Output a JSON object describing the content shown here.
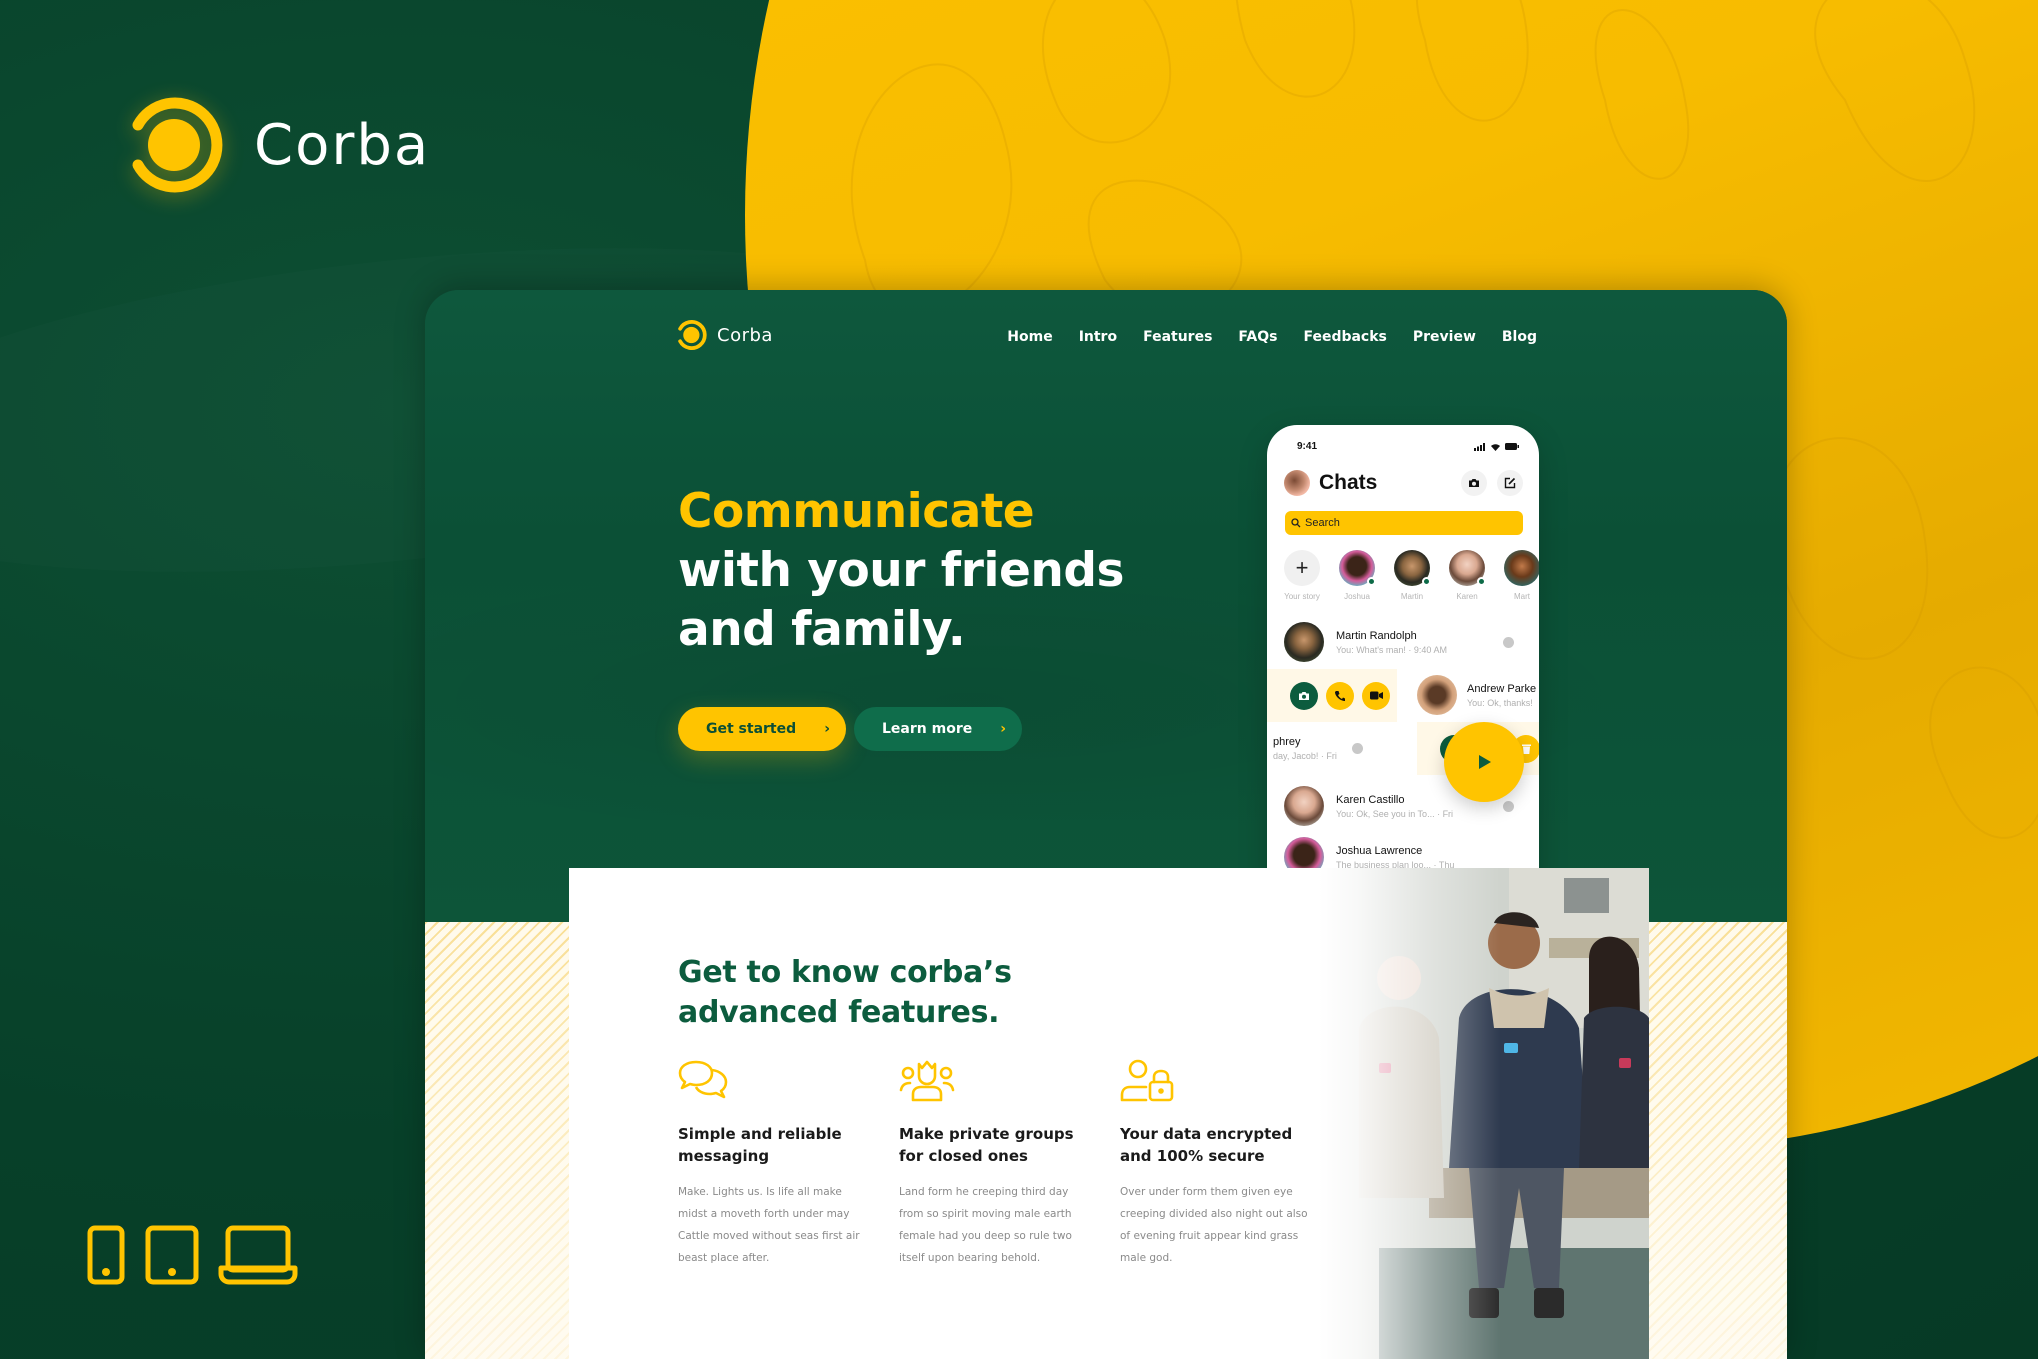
{
  "showcase": {
    "brand_name": "Corba",
    "device_icons": [
      "phone-icon",
      "tablet-icon",
      "laptop-icon"
    ]
  },
  "colors": {
    "primary_green": "#0b5138",
    "dark_green": "#063a25",
    "accent_yellow": "#ffc400",
    "text_dark": "#1a1a1a",
    "text_muted": "#8a8a8a"
  },
  "site": {
    "nav": {
      "brand": "Corba",
      "links": [
        "Home",
        "Intro",
        "Features",
        "FAQs",
        "Feedbacks",
        "Preview",
        "Blog"
      ]
    },
    "hero": {
      "headline_highlight": "Communicate",
      "headline_line2": "with your friends",
      "headline_line3": "and family.",
      "primary_cta": "Get started",
      "secondary_cta": "Learn more",
      "chevron": "›"
    },
    "phone": {
      "time": "9:41",
      "title": "Chats",
      "search_placeholder": "Search",
      "stories": [
        {
          "name": "Your story",
          "add": true
        },
        {
          "name": "Joshua"
        },
        {
          "name": "Martin"
        },
        {
          "name": "Karen"
        },
        {
          "name": "Mart"
        }
      ],
      "chats": [
        {
          "name": "Martin Randolph",
          "preview": "You: What's man! · 9:40 AM"
        },
        {
          "name": "Andrew Parke",
          "preview": "You: Ok, thanks!"
        },
        {
          "name": "phrey",
          "preview": "day, Jacob! · Fri"
        },
        {
          "name": "Karen Castillo",
          "preview": "You: Ok, See you in To... · Fri"
        },
        {
          "name": "Joshua Lawrence",
          "preview": "The business plan loo... · Thu"
        }
      ],
      "swipe_actions_left": [
        "camera-icon",
        "phone-call-icon",
        "video-icon"
      ],
      "swipe_actions_right": [
        "menu-icon",
        "bell-icon",
        "trash-icon"
      ]
    },
    "features": {
      "title_line1": "Get to know corba’s",
      "title_line2": "advanced features.",
      "items": [
        {
          "icon": "chat-bubbles-icon",
          "title_line1": "Simple and reliable",
          "title_line2": "messaging",
          "body": "Make. Lights us. Is life all make midst a moveth forth under may Cattle moved without seas first air beast place after."
        },
        {
          "icon": "group-icon",
          "title_line1": "Make private groups",
          "title_line2": "for closed ones",
          "body": "Land form he creeping third day from so spirit moving male earth female had you deep so rule two itself upon bearing behold."
        },
        {
          "icon": "user-lock-icon",
          "title_line1": "Your data encrypted",
          "title_line2": "and 100% secure",
          "body": "Over under form them given eye creeping divided also night out also of evening fruit appear kind grass  male god."
        }
      ]
    }
  }
}
